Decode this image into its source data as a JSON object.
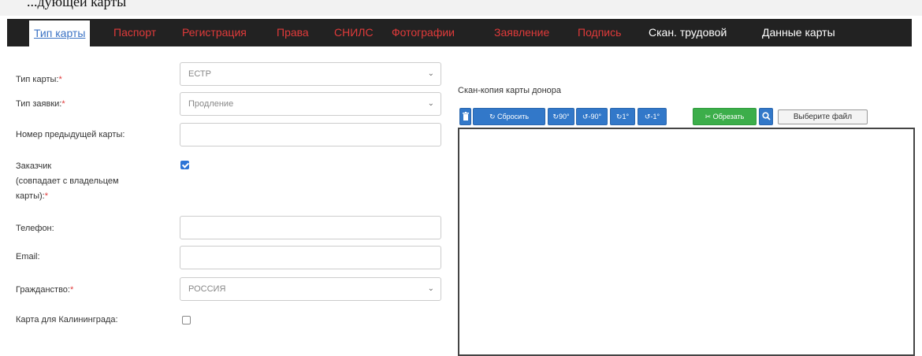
{
  "caption": "...дующей карты",
  "tabs": [
    {
      "label": "Тип карты",
      "state": "active"
    },
    {
      "label": "Паспорт",
      "state": "red"
    },
    {
      "label": "Регистрация",
      "state": "red"
    },
    {
      "label": "Права",
      "state": "red"
    },
    {
      "label": "СНИЛС",
      "state": "red"
    },
    {
      "label": "Фотографии",
      "state": "red"
    },
    {
      "label": "Заявление",
      "state": "red"
    },
    {
      "label": "Подпись",
      "state": "red"
    },
    {
      "label": "Скан. трудовой",
      "state": "white"
    },
    {
      "label": "Данные карты",
      "state": "white"
    }
  ],
  "form": {
    "card_type": {
      "label": "Тип карты:",
      "required": "*",
      "value": "ЕСТР"
    },
    "request_type": {
      "label": "Тип заявки:",
      "required": "*",
      "value": "Продление"
    },
    "prev_card": {
      "label": "Номер предыдущей карты:",
      "value": ""
    },
    "customer": {
      "label_line1": "Заказчик",
      "label_line2": "(совпадает с владельцем",
      "label_line3": "карты):",
      "required": "*",
      "checked": true
    },
    "phone": {
      "label": "Телефон:",
      "value": ""
    },
    "email": {
      "label": "Email:",
      "value": ""
    },
    "citizenship": {
      "label": "Гражданство:",
      "required": "*",
      "value": "РОССИЯ"
    },
    "kaliningrad": {
      "label": "Карта для Калининграда:",
      "checked": false
    }
  },
  "scan": {
    "title": "Скан-копия карты донора",
    "buttons": {
      "delete_icon": "trash-icon",
      "reset": "Сбросить",
      "rot90": "90°",
      "rotm90": "-90°",
      "rot1": "1°",
      "rotm1": "-1°",
      "crop": "Обрезать",
      "zoom_icon": "search-icon"
    },
    "file_button": "Выберите файл"
  },
  "colors": {
    "tabbar_bg": "#222222",
    "tab_red": "#e03a3a",
    "tab_active": "#3a72c4",
    "btn_blue": "#3278c9",
    "btn_green": "#3cae4a",
    "checkbox": "#2b74d6"
  }
}
